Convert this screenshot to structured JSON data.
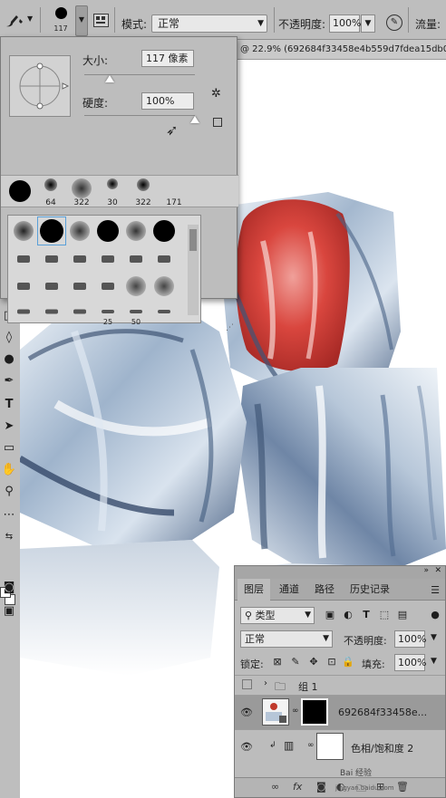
{
  "options_bar": {
    "brush_size": "117",
    "mode_label": "模式:",
    "mode_value": "正常",
    "opacity_label": "不透明度:",
    "opacity_value": "100%",
    "flow_label": "流量:"
  },
  "document_tab": {
    "title": "@ 22.9% (692684f33458e4b559d7fdea15db0a"
  },
  "brush_picker": {
    "size_label": "大小:",
    "size_value": "117 像素",
    "size_fraction": 0.23,
    "hardness_label": "硬度:",
    "hardness_value": "100%",
    "hardness_fraction": 1.0,
    "recent_brushes": [
      "",
      "64",
      "322",
      "30",
      "322",
      "171"
    ],
    "grid_numbers": [
      "25",
      "50"
    ]
  },
  "layers_panel": {
    "tabs": [
      "图层",
      "通道",
      "路径",
      "历史记录"
    ],
    "filter_value": "类型",
    "blend_mode": "正常",
    "opacity_label": "不透明度:",
    "opacity_value": "100%",
    "lock_label": "锁定:",
    "fill_label": "填充:",
    "fill_value": "100%",
    "layers": [
      {
        "name": "组 1",
        "type": "group"
      },
      {
        "name": "692684f33458e...",
        "type": "smart-object"
      },
      {
        "name": "色相/饱和度 2",
        "type": "adjustment"
      }
    ]
  },
  "watermark": {
    "brand": "Bai 经验",
    "url": "jingyan.baidu.com"
  },
  "colors": {
    "panel_bg": "#bdbdbd",
    "field_bg": "#e8e8e8",
    "active_blue": "#5aa0d8"
  }
}
